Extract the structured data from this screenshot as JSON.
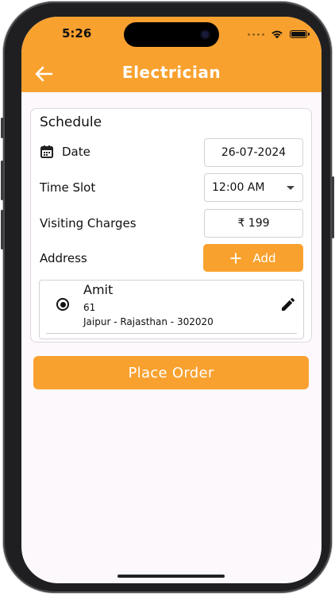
{
  "status_bar": {
    "time": "5:26"
  },
  "header": {
    "title": "Electrician",
    "back_icon": "arrow-left-icon"
  },
  "schedule": {
    "title": "Schedule",
    "date": {
      "label": "Date",
      "value": "26-07-2024",
      "icon": "calendar-icon"
    },
    "time_slot": {
      "label": "Time Slot",
      "value": "12:00 AM"
    },
    "visiting_charges": {
      "label": "Visiting Charges",
      "value": "₹ 199"
    },
    "address": {
      "label": "Address",
      "add_button": "Add",
      "selected": {
        "name": "Amit",
        "line1": "61",
        "line2": "Jaipur - Rajasthan - 302020"
      }
    }
  },
  "actions": {
    "place_order": "Place Order"
  },
  "colors": {
    "accent": "#f9a12f",
    "background": "#fcf8fc",
    "text": "#111111"
  }
}
